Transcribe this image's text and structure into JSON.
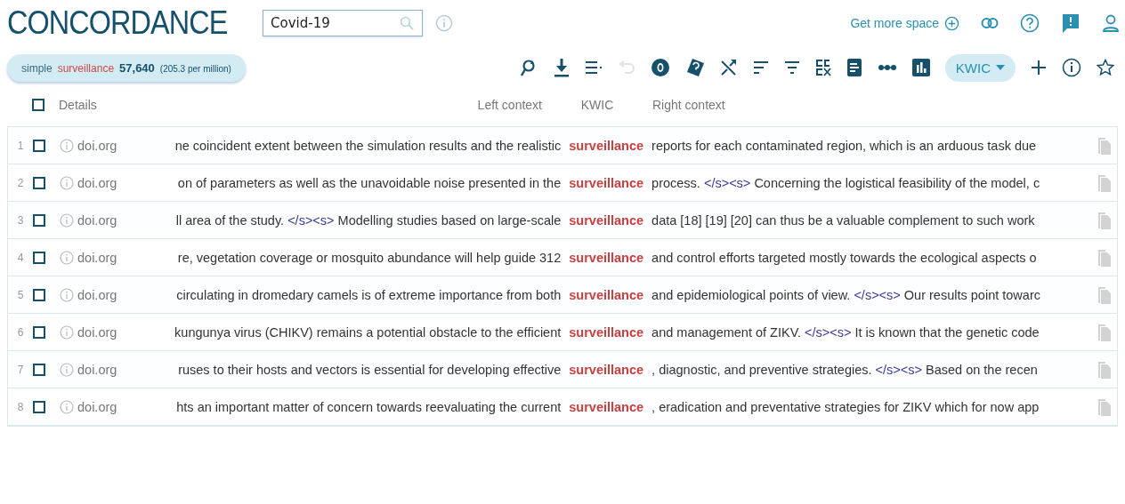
{
  "title": "CONCORDANCE",
  "search": {
    "value": "Covid-19"
  },
  "header_links": {
    "more_space": "Get more space"
  },
  "summary": {
    "query_type": "simple",
    "query": "surveillance",
    "hits": "57,640",
    "per_million": "(205.3 per million)"
  },
  "toolbar": {
    "undo_disabled": true,
    "view": "KWIC"
  },
  "columns": {
    "details": "Details",
    "left": "Left context",
    "kwic": "KWIC",
    "right": "Right context"
  },
  "select_all": {
    "checked": false
  },
  "rows": [
    {
      "number": "1",
      "checked": false,
      "source": "doi.org",
      "left": [
        {
          "kind": "text",
          "text": "ne coincident extent between the simulation results and the realistic"
        }
      ],
      "kwic": "surveillance",
      "right": [
        {
          "kind": "text",
          "text": "reports for each contaminated region, which is an arduous task due"
        }
      ]
    },
    {
      "number": "2",
      "checked": false,
      "source": "doi.org",
      "left": [
        {
          "kind": "text",
          "text": "on of parameters as well as the unavoidable noise presented in the"
        }
      ],
      "kwic": "surveillance",
      "right": [
        {
          "kind": "text",
          "text": "process."
        },
        {
          "kind": "tag",
          "text": "</s><s>"
        },
        {
          "kind": "text",
          "text": "Concerning the logistical feasibility of the model, c"
        }
      ]
    },
    {
      "number": "3",
      "checked": false,
      "source": "doi.org",
      "left": [
        {
          "kind": "text",
          "text": "ll area of the study."
        },
        {
          "kind": "tag",
          "text": "</s><s>"
        },
        {
          "kind": "text",
          "text": "Modelling studies based on large-scale"
        }
      ],
      "kwic": "surveillance",
      "right": [
        {
          "kind": "text",
          "text": "data [18] [19] [20] can thus be a valuable complement to such work"
        }
      ]
    },
    {
      "number": "4",
      "checked": false,
      "source": "doi.org",
      "left": [
        {
          "kind": "text",
          "text": "re, vegetation coverage or mosquito abundance will help guide 312"
        }
      ],
      "kwic": "surveillance",
      "right": [
        {
          "kind": "text",
          "text": "and control efforts targeted mostly towards the ecological aspects o"
        }
      ]
    },
    {
      "number": "5",
      "checked": false,
      "source": "doi.org",
      "left": [
        {
          "kind": "text",
          "text": "circulating in dromedary camels is of extreme importance from both"
        }
      ],
      "kwic": "surveillance",
      "right": [
        {
          "kind": "text",
          "text": "and epidemiological points of view."
        },
        {
          "kind": "tag",
          "text": "</s><s>"
        },
        {
          "kind": "text",
          "text": "Our results point towarc"
        }
      ]
    },
    {
      "number": "6",
      "checked": false,
      "source": "doi.org",
      "left": [
        {
          "kind": "text",
          "text": "kungunya virus (CHIKV) remains a potential obstacle to the efficient"
        }
      ],
      "kwic": "surveillance",
      "right": [
        {
          "kind": "text",
          "text": "and management of ZIKV."
        },
        {
          "kind": "tag",
          "text": "</s><s>"
        },
        {
          "kind": "text",
          "text": "It is known that the genetic code"
        }
      ]
    },
    {
      "number": "7",
      "checked": false,
      "source": "doi.org",
      "left": [
        {
          "kind": "text",
          "text": "ruses to their hosts and vectors is essential for developing effective"
        }
      ],
      "kwic": "surveillance",
      "right": [
        {
          "kind": "text",
          "text": ", diagnostic, and preventive strategies."
        },
        {
          "kind": "tag",
          "text": "</s><s>"
        },
        {
          "kind": "text",
          "text": "Based on the recen"
        }
      ]
    },
    {
      "number": "8",
      "checked": false,
      "source": "doi.org",
      "left": [
        {
          "kind": "text",
          "text": "hts an important matter of concern towards reevaluating the current"
        }
      ],
      "kwic": "surveillance",
      "right": [
        {
          "kind": "text",
          "text": ", eradication and preventative strategies for ZIKV which for now app"
        }
      ]
    }
  ]
}
